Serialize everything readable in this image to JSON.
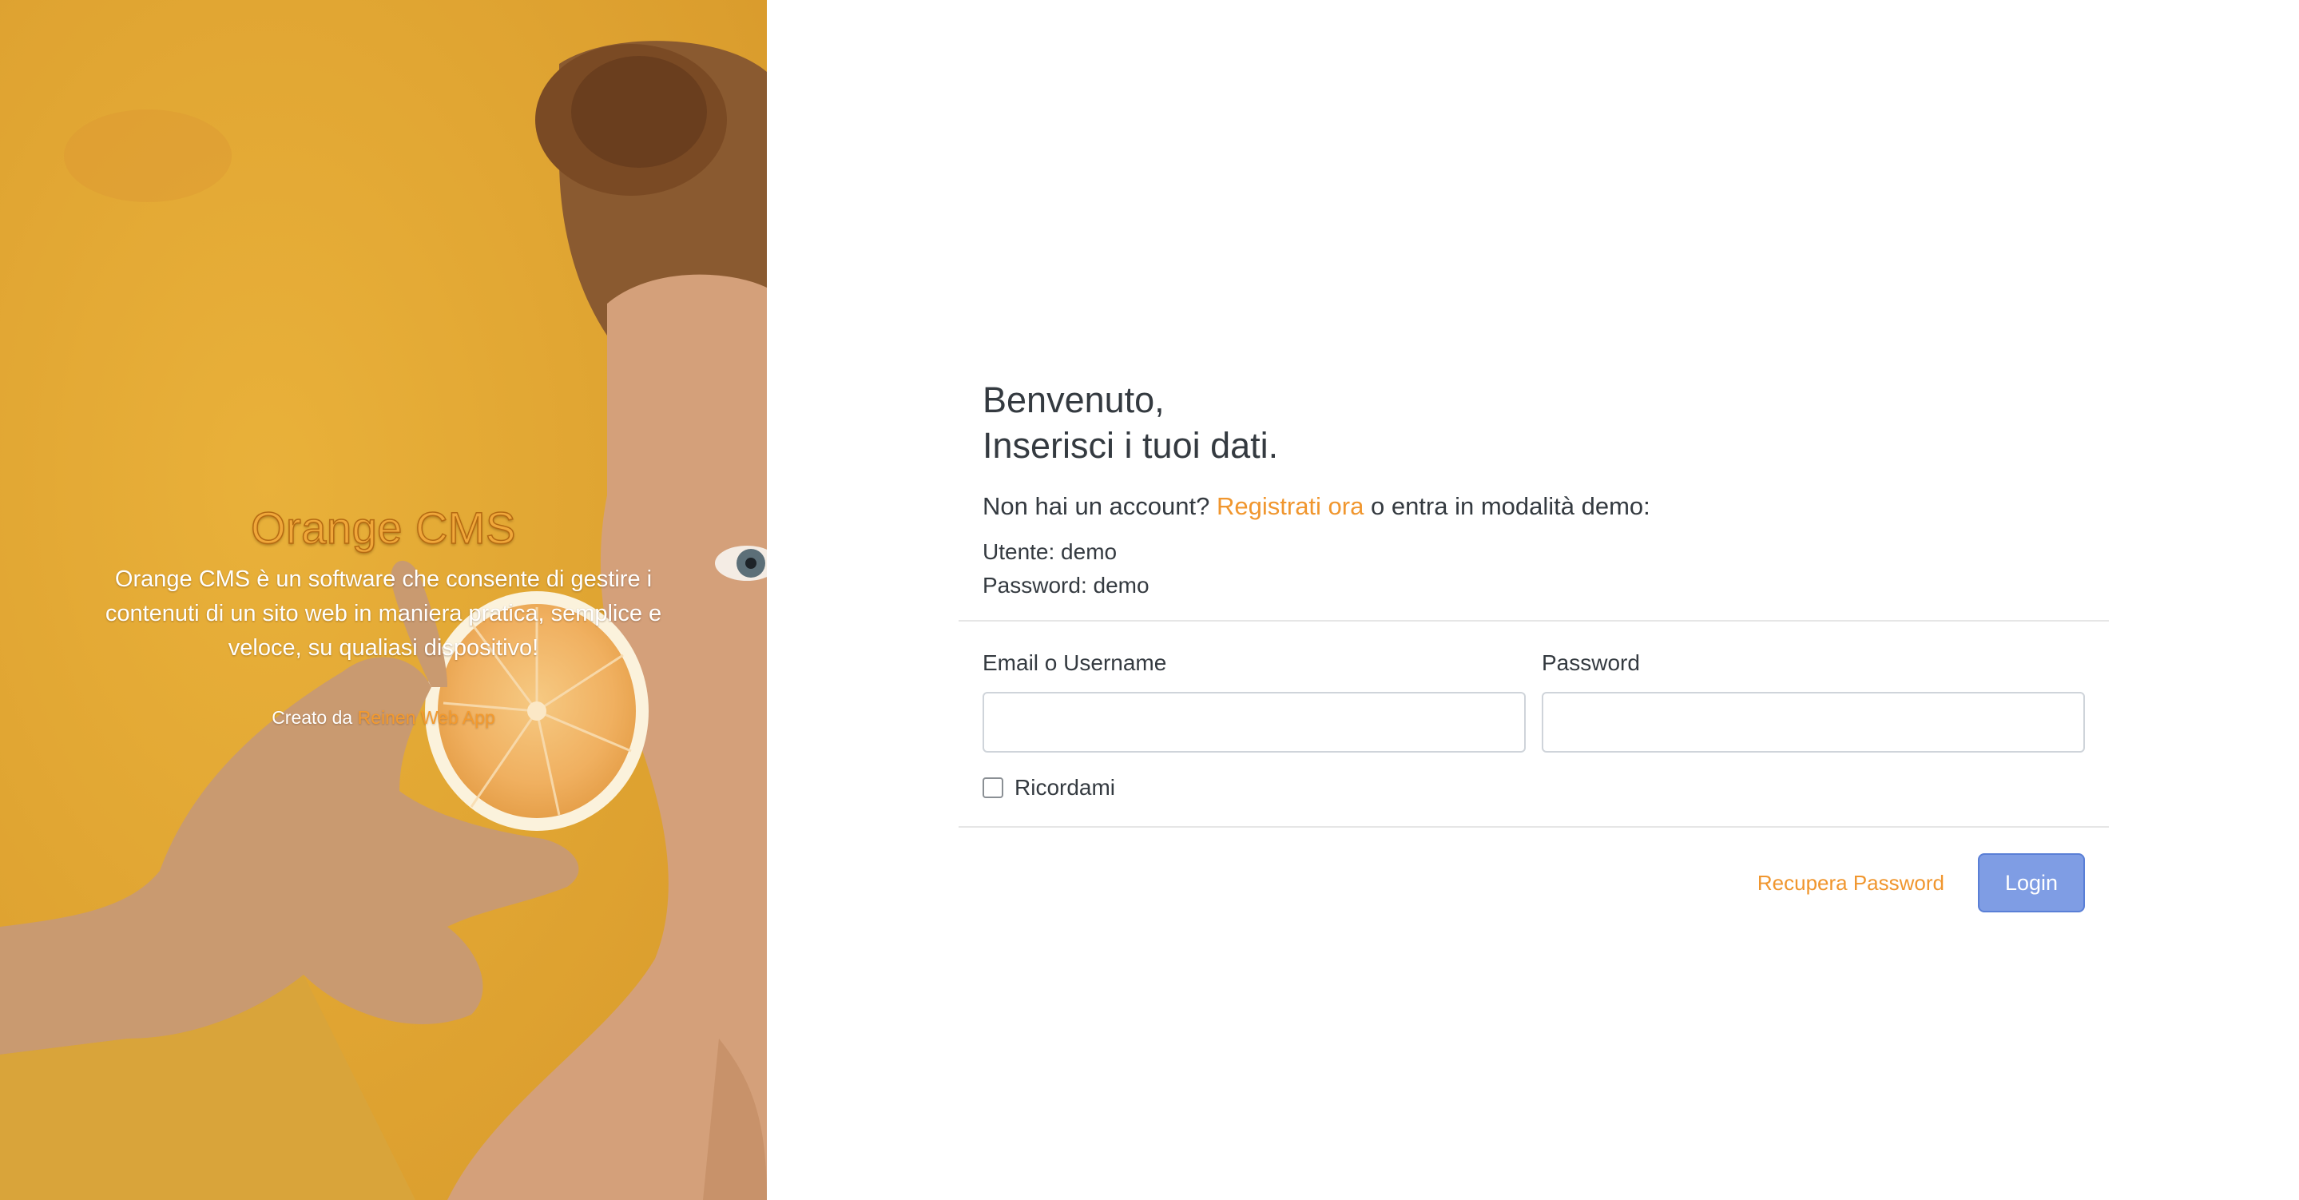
{
  "hero": {
    "title": "Orange CMS",
    "description": "Orange CMS è un software che consente di gestire i contenuti di un sito web in maniera pratica, semplice e veloce, su qualiasi dispositivo!",
    "credit_prefix": "Creato da ",
    "credit_link": "Reinen Web App"
  },
  "login": {
    "welcome_line1": "Benvenuto,",
    "welcome_line2": "Inserisci i tuoi dati.",
    "register_prefix": "Non hai un account? ",
    "register_link": "Registrati ora",
    "register_suffix": " o entra in modalità demo:",
    "demo_user": "Utente: demo",
    "demo_password": "Password: demo",
    "email_label": "Email o Username",
    "email_value": "",
    "password_label": "Password",
    "password_value": "",
    "remember_label": "Ricordami",
    "remember_checked": false,
    "recover_label": "Recupera Password",
    "login_label": "Login"
  },
  "colors": {
    "accent": "#f0962e",
    "hero_bg": "#e0a632",
    "button": "#7f9de4"
  }
}
